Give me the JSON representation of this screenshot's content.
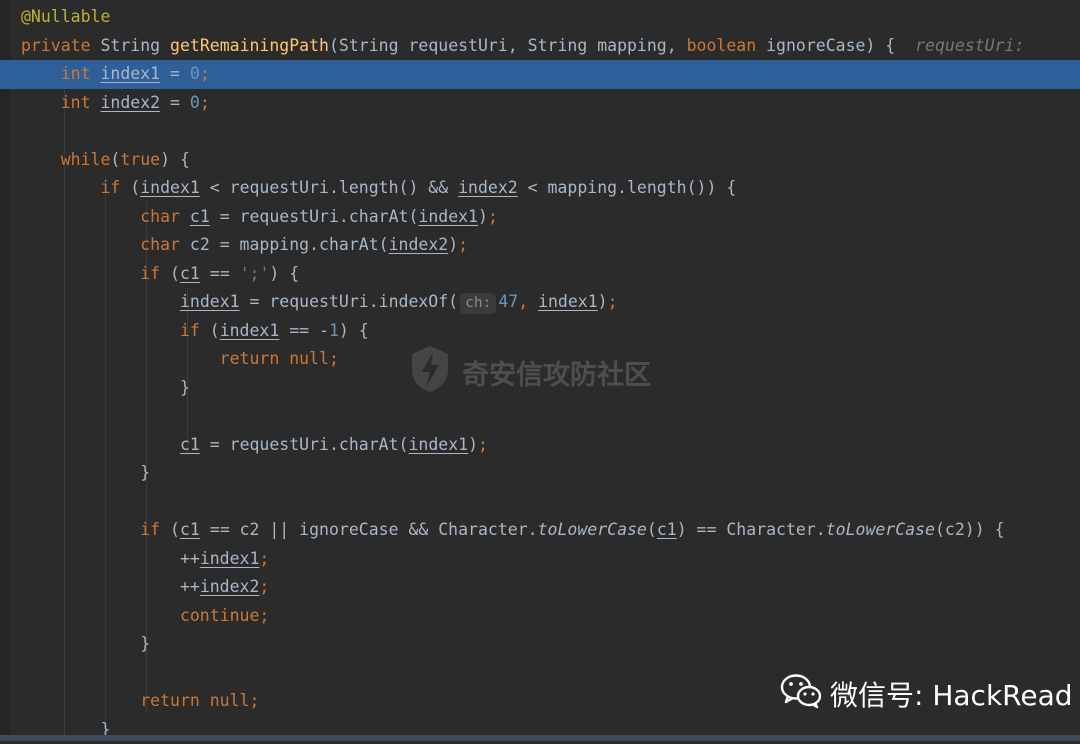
{
  "editor": {
    "lines": [
      {
        "tokens": [
          {
            "t": "@Nullable",
            "c": "ann"
          }
        ]
      },
      {
        "tokens": [
          {
            "t": "private ",
            "c": "kw"
          },
          {
            "t": "String ",
            "c": "plain"
          },
          {
            "t": "getRemainingPath",
            "c": "fn"
          },
          {
            "t": "(String requestUri, String mapping, ",
            "c": "plain"
          },
          {
            "t": "boolean ",
            "c": "kw"
          },
          {
            "t": "ignoreCase) {  ",
            "c": "plain"
          },
          {
            "t": "requestUri: ",
            "c": "inlay"
          }
        ]
      },
      {
        "tokens": [
          {
            "t": "    int ",
            "c": "kw"
          },
          {
            "t": "index1",
            "c": "plain u"
          },
          {
            "t": " = ",
            "c": "plain"
          },
          {
            "t": "0",
            "c": "num"
          },
          {
            "t": ";",
            "c": "kw"
          }
        ]
      },
      {
        "tokens": [
          {
            "t": "    int ",
            "c": "kw"
          },
          {
            "t": "index2",
            "c": "plain u"
          },
          {
            "t": " = ",
            "c": "plain"
          },
          {
            "t": "0",
            "c": "num"
          },
          {
            "t": ";",
            "c": "kw"
          }
        ]
      },
      {
        "tokens": []
      },
      {
        "tokens": [
          {
            "t": "    while",
            "c": "kw"
          },
          {
            "t": "(",
            "c": "plain"
          },
          {
            "t": "true",
            "c": "kw"
          },
          {
            "t": ") {",
            "c": "plain"
          }
        ]
      },
      {
        "tokens": [
          {
            "t": "        if ",
            "c": "kw"
          },
          {
            "t": "(",
            "c": "plain"
          },
          {
            "t": "index1",
            "c": "plain u"
          },
          {
            "t": " < requestUri.length() && ",
            "c": "plain"
          },
          {
            "t": "index2",
            "c": "plain u"
          },
          {
            "t": " < mapping.length()) {",
            "c": "plain"
          }
        ]
      },
      {
        "tokens": [
          {
            "t": "            char ",
            "c": "kw"
          },
          {
            "t": "c1",
            "c": "plain u"
          },
          {
            "t": " = requestUri.charAt(",
            "c": "plain"
          },
          {
            "t": "index1",
            "c": "plain u"
          },
          {
            "t": ")",
            "c": "plain"
          },
          {
            "t": ";",
            "c": "kw"
          }
        ]
      },
      {
        "tokens": [
          {
            "t": "            char ",
            "c": "kw"
          },
          {
            "t": "c2 = mapping.charAt(",
            "c": "plain"
          },
          {
            "t": "index2",
            "c": "plain u"
          },
          {
            "t": ")",
            "c": "plain"
          },
          {
            "t": ";",
            "c": "kw"
          }
        ]
      },
      {
        "tokens": [
          {
            "t": "            if ",
            "c": "kw"
          },
          {
            "t": "(",
            "c": "plain"
          },
          {
            "t": "c1",
            "c": "plain u"
          },
          {
            "t": " == ",
            "c": "plain"
          },
          {
            "t": "';'",
            "c": "str"
          },
          {
            "t": ") {",
            "c": "plain"
          }
        ]
      },
      {
        "tokens": [
          {
            "t": "                ",
            "c": "plain"
          },
          {
            "t": "index1",
            "c": "plain u"
          },
          {
            "t": " = requestUri.indexOf(",
            "c": "plain"
          },
          {
            "t": "ch:",
            "c": "hint"
          },
          {
            "t": "47",
            "c": "num"
          },
          {
            "t": ", ",
            "c": "kw"
          },
          {
            "t": "index1",
            "c": "plain u"
          },
          {
            "t": ")",
            "c": "plain"
          },
          {
            "t": ";",
            "c": "kw"
          }
        ]
      },
      {
        "tokens": [
          {
            "t": "                if ",
            "c": "kw"
          },
          {
            "t": "(",
            "c": "plain"
          },
          {
            "t": "index1",
            "c": "plain u"
          },
          {
            "t": " == -",
            "c": "plain"
          },
          {
            "t": "1",
            "c": "num"
          },
          {
            "t": ") {",
            "c": "plain"
          }
        ]
      },
      {
        "tokens": [
          {
            "t": "                    return null",
            "c": "kw"
          },
          {
            "t": ";",
            "c": "kw"
          }
        ]
      },
      {
        "tokens": [
          {
            "t": "                }",
            "c": "plain"
          }
        ]
      },
      {
        "tokens": []
      },
      {
        "tokens": [
          {
            "t": "                ",
            "c": "plain"
          },
          {
            "t": "c1",
            "c": "plain u"
          },
          {
            "t": " = requestUri.charAt(",
            "c": "plain"
          },
          {
            "t": "index1",
            "c": "plain u"
          },
          {
            "t": ")",
            "c": "plain"
          },
          {
            "t": ";",
            "c": "kw"
          }
        ]
      },
      {
        "tokens": [
          {
            "t": "            }",
            "c": "plain"
          }
        ]
      },
      {
        "tokens": []
      },
      {
        "tokens": [
          {
            "t": "            if ",
            "c": "kw"
          },
          {
            "t": "(",
            "c": "plain"
          },
          {
            "t": "c1",
            "c": "plain u"
          },
          {
            "t": " == c2 || ignoreCase && Character.",
            "c": "plain"
          },
          {
            "t": "toLowerCase",
            "c": "ital"
          },
          {
            "t": "(",
            "c": "plain"
          },
          {
            "t": "c1",
            "c": "plain u"
          },
          {
            "t": ") == Character.",
            "c": "plain"
          },
          {
            "t": "toLowerCase",
            "c": "ital"
          },
          {
            "t": "(c2)) {",
            "c": "plain"
          }
        ]
      },
      {
        "tokens": [
          {
            "t": "                ++",
            "c": "plain"
          },
          {
            "t": "index1",
            "c": "plain u"
          },
          {
            "t": ";",
            "c": "kw"
          }
        ]
      },
      {
        "tokens": [
          {
            "t": "                ++",
            "c": "plain"
          },
          {
            "t": "index2",
            "c": "plain u"
          },
          {
            "t": ";",
            "c": "kw"
          }
        ]
      },
      {
        "tokens": [
          {
            "t": "                continue;",
            "c": "kw"
          }
        ]
      },
      {
        "tokens": [
          {
            "t": "            }",
            "c": "plain"
          }
        ]
      },
      {
        "tokens": []
      },
      {
        "tokens": [
          {
            "t": "            return null",
            "c": "kw"
          },
          {
            "t": ";",
            "c": "kw"
          }
        ]
      },
      {
        "tokens": [
          {
            "t": "        }",
            "c": "plain"
          }
        ]
      }
    ],
    "caret_line": 2
  },
  "watermark": {
    "text": "奇安信攻防社区",
    "icon": "lightning-shield-icon"
  },
  "wechat": {
    "text": "微信号: HackRead",
    "icon": "wechat-icon"
  },
  "colors": {
    "background": "#2b2b2b",
    "keyword": "#cc7832",
    "annotation": "#bbb529",
    "method": "#ffc66d",
    "number": "#6897bb",
    "string": "#6a8759",
    "caret_line": "#2f5f98"
  }
}
